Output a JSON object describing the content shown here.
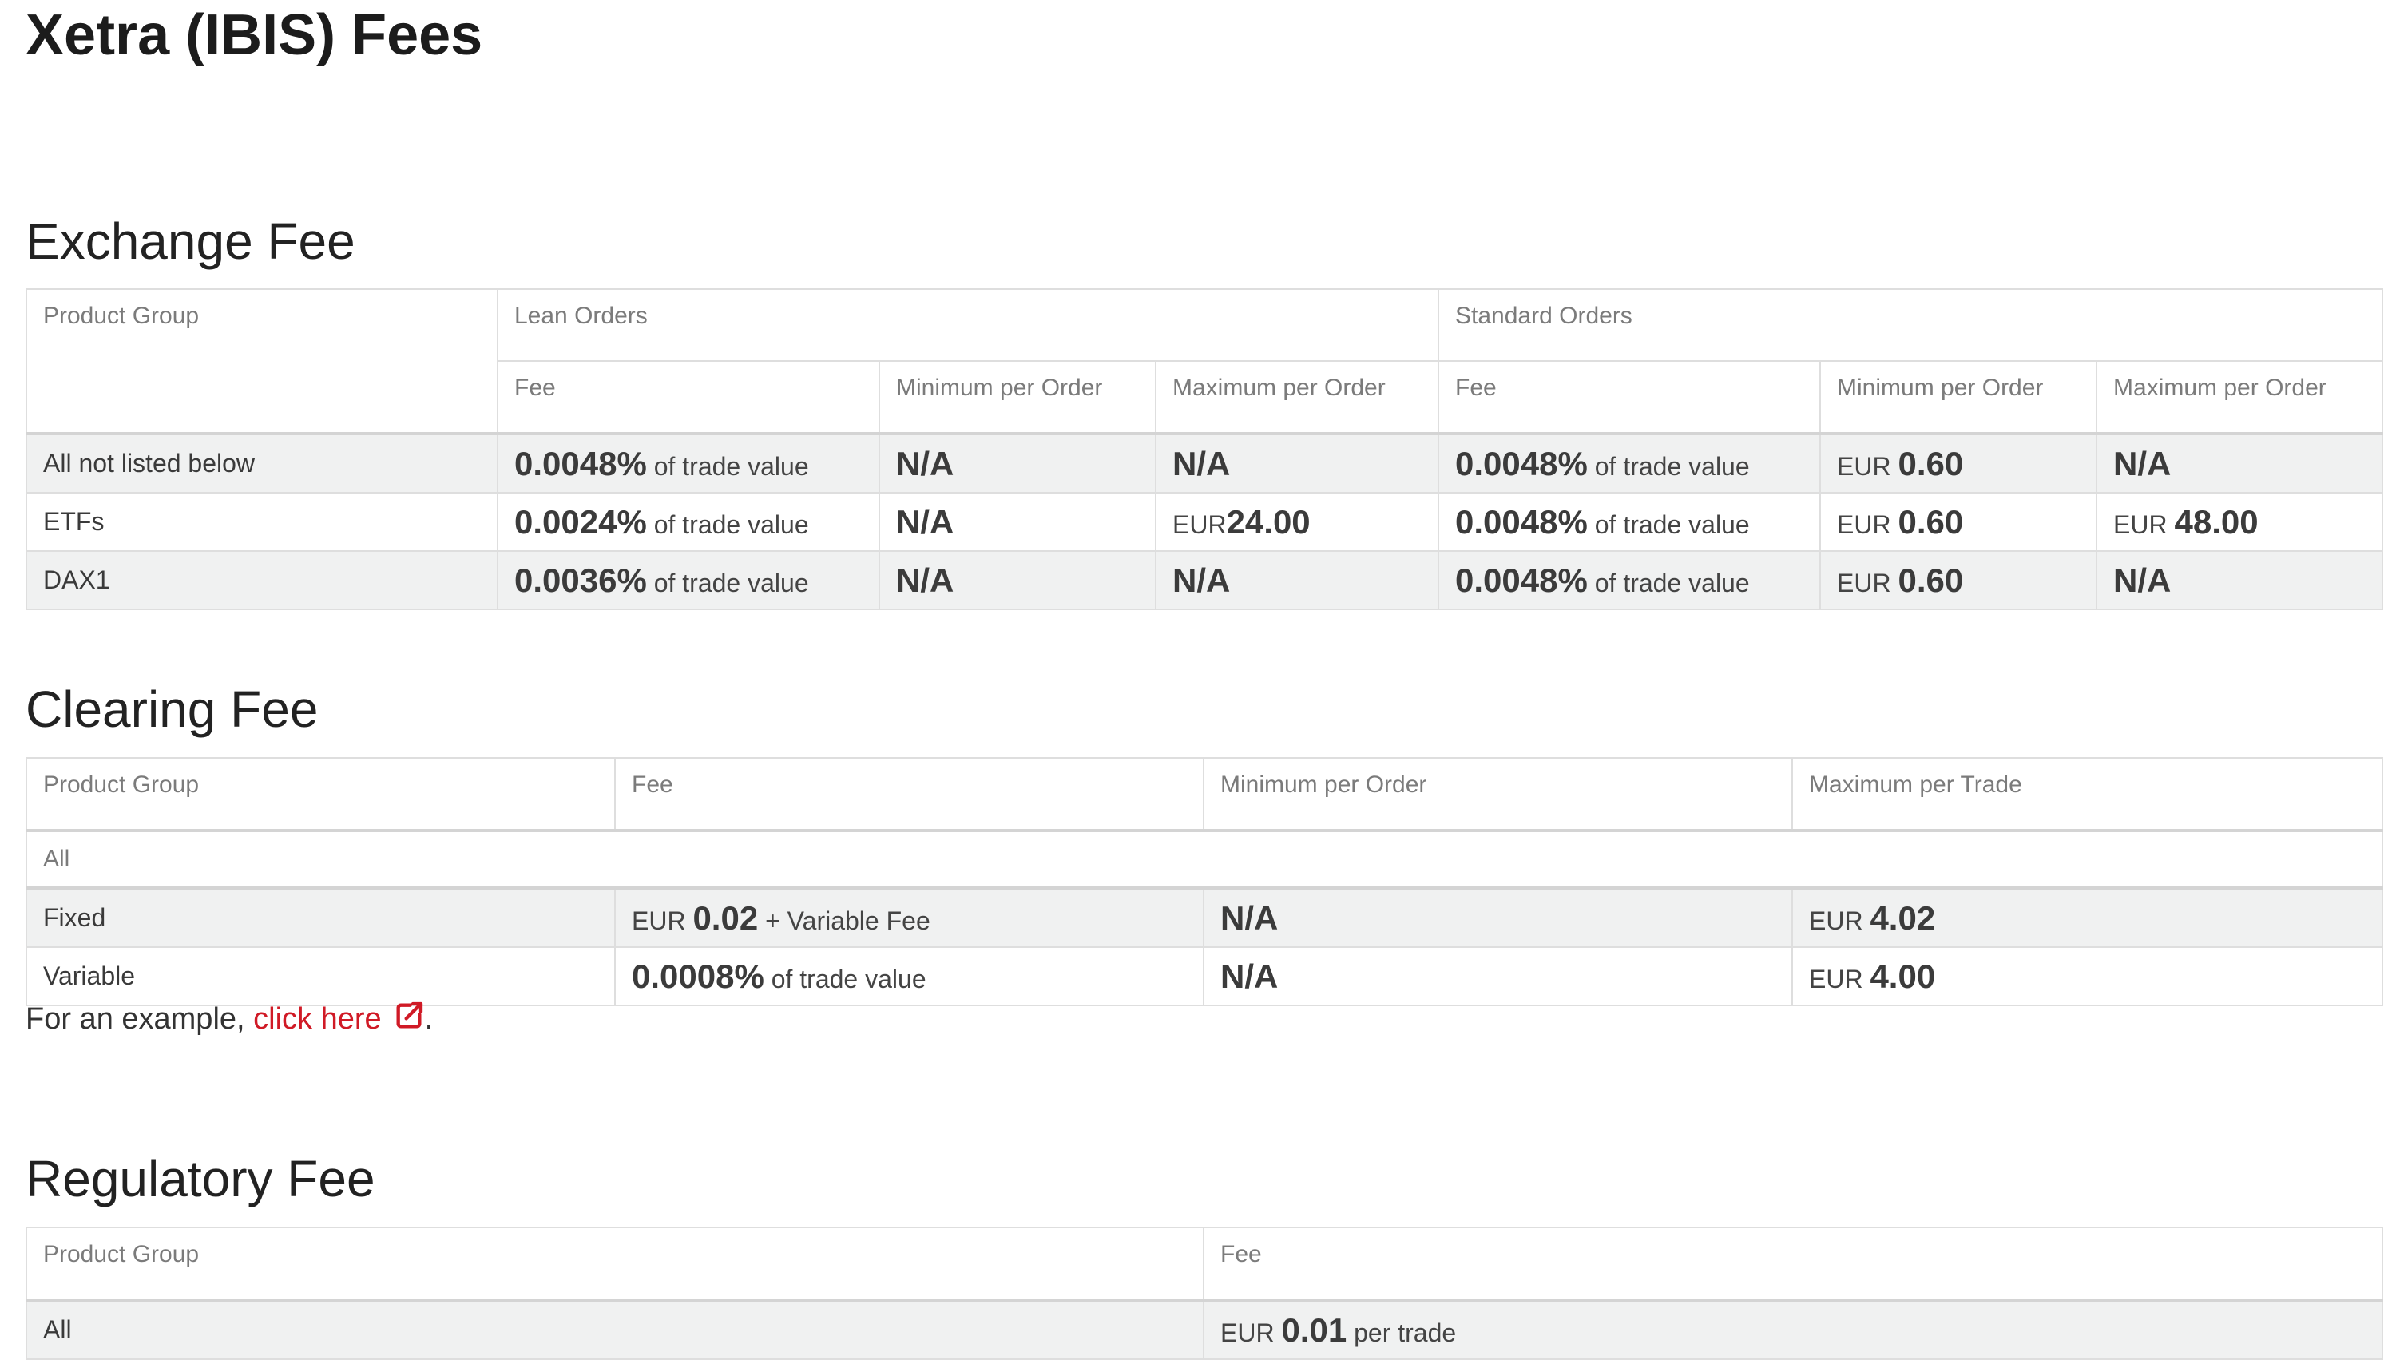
{
  "page_title": "Xetra (IBIS) Fees",
  "exchange_fee": {
    "title": "Exchange Fee",
    "headers": {
      "product_group": "Product Group",
      "lean_orders": "Lean Orders",
      "standard_orders": "Standard Orders",
      "fee": "Fee",
      "minimum_per_order": "Minimum per Order",
      "maximum_per_order": "Maximum per Order"
    },
    "rows": [
      {
        "product_group": "All not listed below",
        "lean_fee": {
          "value": "0.0048%",
          "unit": "of trade value"
        },
        "lean_min": {
          "currency": "",
          "value": "N/A"
        },
        "lean_max": {
          "currency": "",
          "value": "N/A"
        },
        "std_fee": {
          "value": "0.0048%",
          "unit": "of trade value"
        },
        "std_min": {
          "currency": "EUR",
          "value": "0.60"
        },
        "std_max": {
          "currency": "",
          "value": "N/A"
        }
      },
      {
        "product_group": "ETFs",
        "lean_fee": {
          "value": "0.0024%",
          "unit": "of trade value"
        },
        "lean_min": {
          "currency": "",
          "value": "N/A"
        },
        "lean_max": {
          "currency": "EUR",
          "value": "24.00"
        },
        "std_fee": {
          "value": "0.0048%",
          "unit": "of trade value"
        },
        "std_min": {
          "currency": "EUR",
          "value": "0.60"
        },
        "std_max": {
          "currency": "EUR",
          "value": "48.00"
        }
      },
      {
        "product_group": "DAX1",
        "lean_fee": {
          "value": "0.0036%",
          "unit": "of trade value"
        },
        "lean_min": {
          "currency": "",
          "value": "N/A"
        },
        "lean_max": {
          "currency": "",
          "value": "N/A"
        },
        "std_fee": {
          "value": "0.0048%",
          "unit": "of trade value"
        },
        "std_min": {
          "currency": "EUR",
          "value": "0.60"
        },
        "std_max": {
          "currency": "",
          "value": "N/A"
        }
      }
    ]
  },
  "clearing_fee": {
    "title": "Clearing Fee",
    "headers": {
      "product_group": "Product Group",
      "fee": "Fee",
      "minimum_per_order": "Minimum per Order",
      "maximum_per_trade": "Maximum per Trade"
    },
    "group_label": "All",
    "rows": [
      {
        "product_group": "Fixed",
        "fee": {
          "currency": "EUR",
          "value": "0.02",
          "suffix": "+ Variable Fee"
        },
        "min": {
          "value": "N/A"
        },
        "max": {
          "currency": "EUR",
          "value": "4.02"
        }
      },
      {
        "product_group": "Variable",
        "fee": {
          "value": "0.0008%",
          "suffix": "of trade value"
        },
        "min": {
          "value": "N/A"
        },
        "max": {
          "currency": "EUR",
          "value": "4.00"
        }
      }
    ],
    "example": {
      "prefix": "For an example,",
      "link_text": "click here",
      "suffix": ".",
      "link_color": "#d01a26",
      "icon": "external-link-icon"
    }
  },
  "regulatory_fee": {
    "title": "Regulatory Fee",
    "headers": {
      "product_group": "Product Group",
      "fee": "Fee"
    },
    "rows": [
      {
        "product_group": "All",
        "fee": {
          "currency": "EUR",
          "value": "0.01",
          "suffix": "per trade"
        }
      }
    ]
  }
}
